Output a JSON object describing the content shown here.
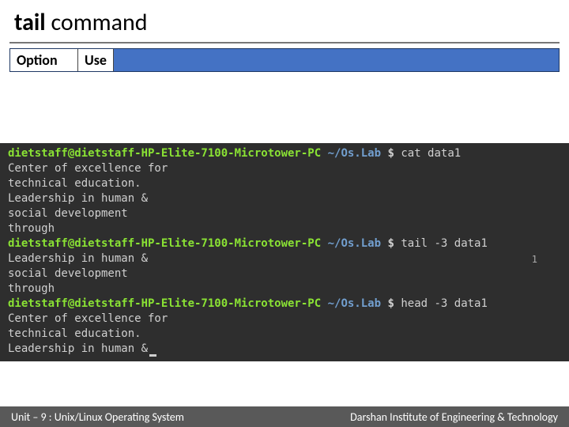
{
  "title": {
    "bold": "tail",
    "rest": " command"
  },
  "options": {
    "col1": "Option",
    "col2": "Use"
  },
  "term": {
    "prompt_user": "dietstaff@dietstaff-HP-Elite-7100-Microtower-PC",
    "prompt_path": "~/Os.Lab",
    "prompt_sym": "$",
    "cmd1": "cat data1",
    "out1": [
      "Center of excellence for",
      "technical education.",
      "Leadership in human &",
      "social development",
      "through"
    ],
    "cmd2": "tail -3 data1",
    "out2": [
      "Leadership in human &",
      "social development",
      "through"
    ],
    "cmd3": "head -3 data1",
    "out3": [
      "Center of excellence for",
      "technical education.",
      "Leadership in human &"
    ],
    "rnum": "1"
  },
  "footer": {
    "left": "Unit – 9 : Unix/Linux Operating System",
    "right": "Darshan Institute of Engineering & Technology"
  }
}
